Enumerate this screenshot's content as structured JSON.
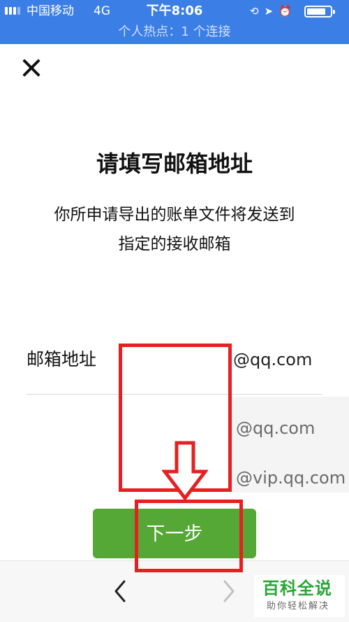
{
  "status_bar": {
    "carrier": "中国移动",
    "network": "4G",
    "time": "下午8:06",
    "icons": [
      "rotation-lock-icon",
      "location-icon",
      "alarm-icon",
      "battery-icon"
    ]
  },
  "hotspot_banner": "个人热点：1 个连接",
  "title": "请填写邮箱地址",
  "description": [
    "你所申请导出的账单文件将发送到",
    "指定的接收邮箱"
  ],
  "email_field": {
    "label": "邮箱地址",
    "value": "",
    "suffix": "@qq.com"
  },
  "suggestions": [
    "@qq.com",
    "@vip.qq.com"
  ],
  "next_button": "下一步",
  "watermark": {
    "main": "百科全说",
    "sub": "助你轻松解决"
  },
  "colors": {
    "status_bar": "#3b7ee6",
    "primary_button": "#56a836",
    "annotation": "#e62020",
    "watermark": "#2aa538"
  }
}
